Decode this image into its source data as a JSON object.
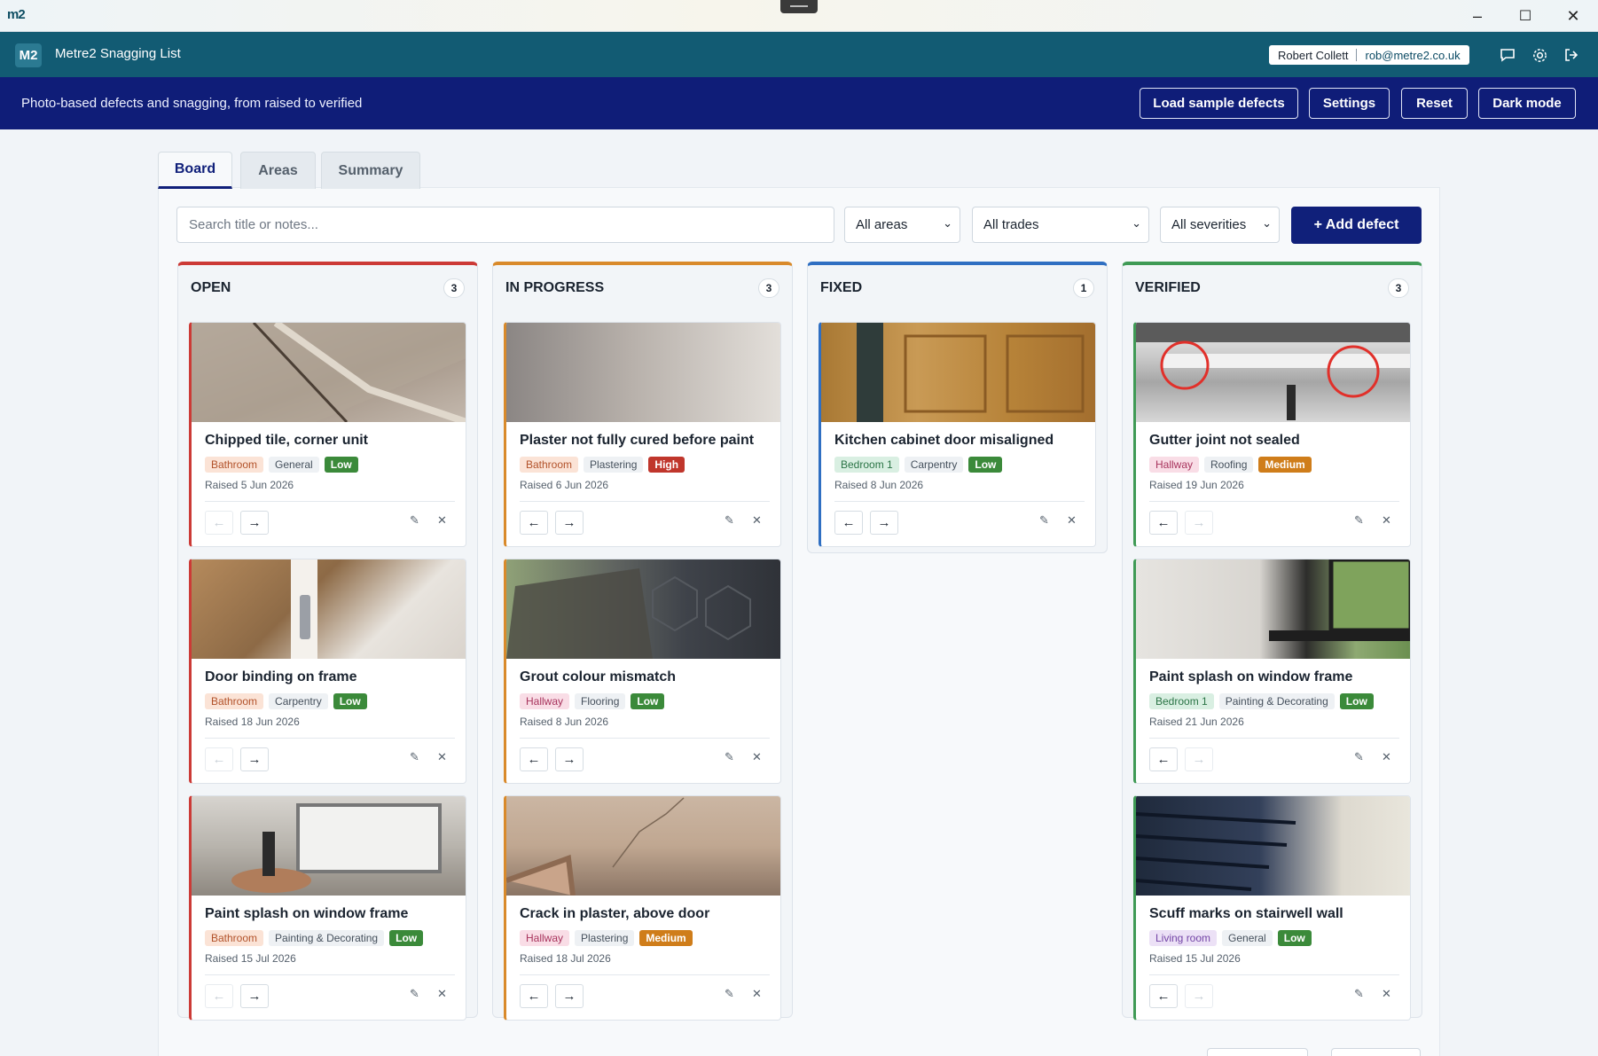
{
  "window": {
    "logo": "m2",
    "minimize": "–",
    "maximize": "☐",
    "close": "✕"
  },
  "app": {
    "badge": "M2",
    "title": "Metre2 Snagging List",
    "user_name": "Robert Collett",
    "user_email": "rob@metre2.co.uk"
  },
  "banner": {
    "text": "Photo-based defects and snagging, from raised to verified",
    "buttons": [
      "Load sample defects",
      "Settings",
      "Reset",
      "Dark mode"
    ]
  },
  "tabs": [
    "Board",
    "Areas",
    "Summary"
  ],
  "filters": {
    "search_placeholder": "Search title or notes...",
    "areas": "All areas",
    "trades": "All trades",
    "severities": "All severities",
    "add_label": "+ Add defect"
  },
  "columns": [
    {
      "title": "OPEN",
      "count": "3",
      "accent": "#cc3a36",
      "cards": [
        {
          "title": "Chipped tile, corner unit",
          "area": "Bathroom",
          "trade": "General",
          "severity": "Low",
          "raised": "Raised 5 Jun 2026"
        },
        {
          "title": "Door binding on frame",
          "area": "Bathroom",
          "trade": "Carpentry",
          "severity": "Low",
          "raised": "Raised 18 Jun 2026"
        },
        {
          "title": "Paint splash on window frame",
          "area": "Bathroom",
          "trade": "Painting & Decorating",
          "severity": "Low",
          "raised": "Raised 15 Jul 2026"
        }
      ]
    },
    {
      "title": "IN PROGRESS",
      "count": "3",
      "accent": "#d98a2b",
      "cards": [
        {
          "title": "Plaster not fully cured before paint",
          "area": "Bathroom",
          "trade": "Plastering",
          "severity": "High",
          "raised": "Raised 6 Jun 2026"
        },
        {
          "title": "Grout colour mismatch",
          "area": "Hallway",
          "trade": "Flooring",
          "severity": "Low",
          "raised": "Raised 8 Jun 2026"
        },
        {
          "title": "Crack in plaster, above door",
          "area": "Hallway",
          "trade": "Plastering",
          "severity": "Medium",
          "raised": "Raised 18 Jul 2026"
        }
      ]
    },
    {
      "title": "FIXED",
      "count": "1",
      "accent": "#2f6fc2",
      "cards": [
        {
          "title": "Kitchen cabinet door misaligned",
          "area": "Bedroom 1",
          "trade": "Carpentry",
          "severity": "Low",
          "raised": "Raised 8 Jun 2026"
        }
      ]
    },
    {
      "title": "VERIFIED",
      "count": "3",
      "accent": "#3f9a55",
      "cards": [
        {
          "title": "Gutter joint not sealed",
          "area": "Hallway",
          "trade": "Roofing",
          "severity": "Medium",
          "raised": "Raised 19 Jun 2026"
        },
        {
          "title": "Paint splash on window frame",
          "area": "Bedroom 1",
          "trade": "Painting & Decorating",
          "severity": "Low",
          "raised": "Raised 21 Jun 2026"
        },
        {
          "title": "Scuff marks on stairwell wall",
          "area": "Living room",
          "trade": "General",
          "severity": "Low",
          "raised": "Raised 15 Jul 2026"
        }
      ]
    }
  ],
  "card_actions": {
    "prev": "←",
    "next": "→",
    "edit": "✎",
    "delete": "✕"
  },
  "colors": {
    "low": "#3b8a3a",
    "medium": "#cf7d1a",
    "high": "#c0362c",
    "brand": "#10207a",
    "appbar": "#125b73"
  }
}
